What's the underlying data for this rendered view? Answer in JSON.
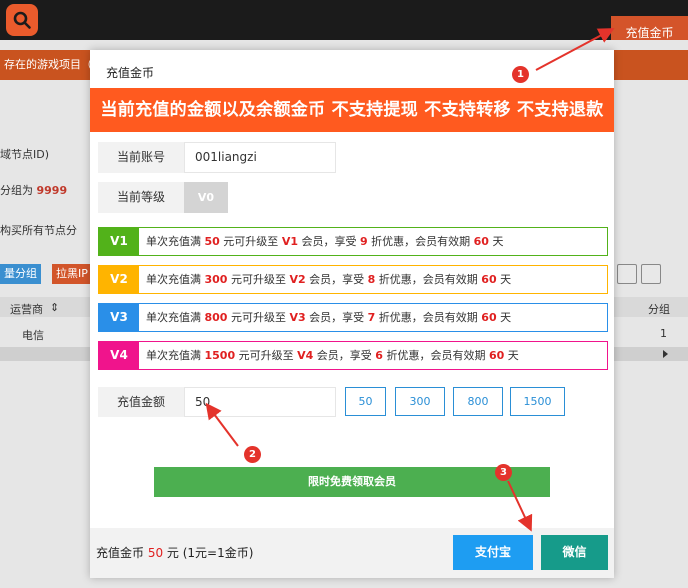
{
  "background": {
    "top_recharge_label": "充值金币",
    "orange_strip_text": "存在的游戏项目（",
    "line1": "域节点ID)",
    "line2_prefix": "分组为 ",
    "line2_value": "9999",
    "line3": "构买所有节点分",
    "tab1": "量分组",
    "tab2": "拉黑IP",
    "col_operator": "运营商",
    "col_sort": "⇕",
    "col_group": "分组",
    "cell_operator": "电信",
    "cell_group": "1"
  },
  "modal": {
    "title": "充值金币",
    "banner": "当前充值的金额以及余额金币 不支持提现 不支持转移 不支持退款",
    "account_label": "当前账号",
    "account_value": "001liangzi",
    "level_label": "当前等级",
    "level_value": "V0",
    "vip_levels": [
      {
        "tag": "V1",
        "t1": "单次充值满 ",
        "amount": "50",
        "t2": " 元可升级至 ",
        "level": "V1",
        "t3": " 会员，享受 ",
        "discount": "9",
        "t4": " 折优惠，会员有效期 ",
        "days": "60",
        "t5": " 天",
        "color": "#52b21a"
      },
      {
        "tag": "V2",
        "t1": "单次充值满 ",
        "amount": "300",
        "t2": " 元可升级至 ",
        "level": "V2",
        "t3": " 会员，享受 ",
        "discount": "8",
        "t4": " 折优惠，会员有效期 ",
        "days": "60",
        "t5": " 天",
        "color": "#ffb400"
      },
      {
        "tag": "V3",
        "t1": "单次充值满 ",
        "amount": "800",
        "t2": " 元可升级至 ",
        "level": "V3",
        "t3": " 会员，享受 ",
        "discount": "7",
        "t4": " 折优惠，会员有效期 ",
        "days": "60",
        "t5": " 天",
        "color": "#2a8fe8"
      },
      {
        "tag": "V4",
        "t1": "单次充值满 ",
        "amount": "1500",
        "t2": " 元可升级至 ",
        "level": "V4",
        "t3": " 会员，享受 ",
        "discount": "6",
        "t4": " 折优惠，会员有效期 ",
        "days": "60",
        "t5": " 天",
        "color": "#f0148c"
      }
    ],
    "amount_label": "充值金额",
    "amount_value": "50",
    "amount_options": [
      "50",
      "300",
      "800",
      "1500"
    ],
    "free_button": "限时免费领取会员",
    "footer_prefix": "充值金币 ",
    "footer_amount": "50",
    "footer_suffix": " 元  (1元=1金币)",
    "alipay_label": "支付宝",
    "wechat_label": "微信",
    "alipay_color": "#1e9df2",
    "wechat_color": "#169b8a"
  },
  "annotations": [
    "1",
    "2",
    "3"
  ],
  "colors": {
    "banner": "#ff5a1f",
    "annotation": "#e4332b",
    "accent_blue": "#2a8fd6"
  }
}
